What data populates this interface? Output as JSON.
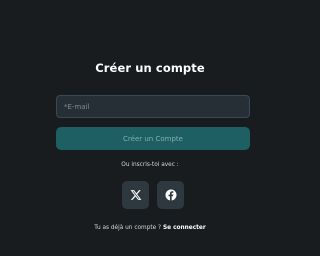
{
  "signup": {
    "title": "Créer un compte",
    "email_placeholder": "*E-mail",
    "submit_label": "Créer un Compte",
    "alt_signup_text": "Ou inscris-toi avec :",
    "social": [
      "x-icon",
      "facebook-icon"
    ]
  },
  "footer": {
    "question": "Tu as déjà un compte ?",
    "login_link": "Se connecter"
  },
  "colors": {
    "background": "#181c1f",
    "field_background": "#262f35",
    "field_border": "#3a4a52",
    "accent": "#1d5f63",
    "social_button": "#2e393f"
  }
}
